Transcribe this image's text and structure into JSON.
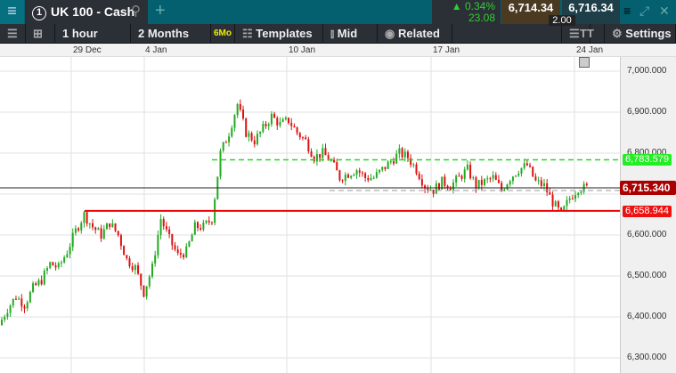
{
  "header": {
    "instrument": "UK 100 - Cash",
    "tab_number": "1",
    "add_tab": "+",
    "change_pct": "▲ 0.34%",
    "change_abs": "23.08",
    "sell": "6,714.34",
    "buy": "6,716.34",
    "spread": "2.00"
  },
  "toolbar": {
    "interval": "1 hour",
    "range": "2 Months",
    "range_badge": "6Mo",
    "templates": "Templates",
    "price_type": "Mid",
    "related": "Related",
    "settings": "Settings",
    "text_size": "TT"
  },
  "chart_data": {
    "type": "candlestick",
    "x_labels": [
      "29 Dec",
      "4 Jan",
      "10 Jan",
      "17 Jan",
      "24 Jan"
    ],
    "y_ticks": [
      "7,000.000",
      "6,900.000",
      "6,800.000",
      "6,600.000",
      "6,500.000",
      "6,400.000",
      "6,300.000"
    ],
    "ylim": [
      6270,
      7035
    ],
    "closes": [
      6380,
      6420,
      6450,
      6430,
      6470,
      6490,
      6530,
      6520,
      6560,
      6610,
      6650,
      6620,
      6600,
      6630,
      6600,
      6540,
      6520,
      6460,
      6520,
      6640,
      6590,
      6550,
      6560,
      6620,
      6620,
      6640,
      6800,
      6850,
      6920,
      6850,
      6830,
      6860,
      6890,
      6870,
      6880,
      6850,
      6830,
      6790,
      6800,
      6780,
      6740,
      6750,
      6760,
      6740,
      6740,
      6760,
      6780,
      6800,
      6790,
      6760,
      6720,
      6710,
      6730,
      6720,
      6740,
      6760,
      6720,
      6730,
      6740,
      6710,
      6740,
      6760,
      6770,
      6730,
      6720,
      6680,
      6650,
      6690,
      6715,
      6715
    ],
    "levels": {
      "green_line": "6,783.579",
      "current": "6,715.340",
      "red_line": "6,658.944"
    },
    "colors": {
      "up": "#22aa22",
      "down": "#dd1111",
      "green_line": "#22dd22",
      "red_line": "#ee0000",
      "current": "#aa0000"
    }
  }
}
